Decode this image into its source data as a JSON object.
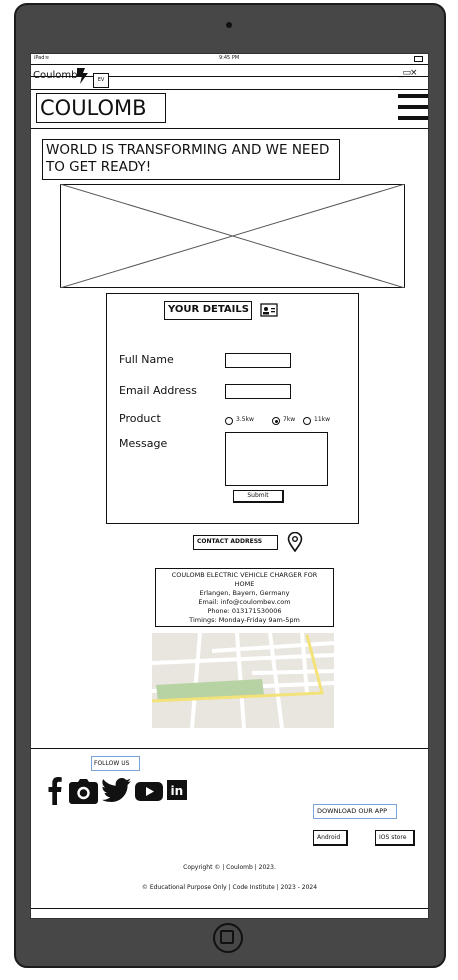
{
  "status_bar": {
    "device": "iPad",
    "time": "9:45 PM"
  },
  "browser": {
    "app_title": "Coulomb",
    "badge": "EV",
    "controls": "_▭×"
  },
  "header": {
    "logo": "COULOMB"
  },
  "hero": {
    "headline": "WORLD IS TRANSFORMING AND WE NEED TO GET READY!"
  },
  "form": {
    "title": "YOUR DETAILS",
    "fields": [
      "Full Name",
      "Email Address",
      "Product",
      "Message"
    ],
    "options": [
      {
        "label": "3.5kw",
        "selected": false
      },
      {
        "label": "7kw",
        "selected": true
      },
      {
        "label": "11kw",
        "selected": false
      }
    ],
    "submit": "Submit"
  },
  "contact": {
    "title": "CONTACT ADDRESS",
    "lines": [
      "COULOMB ELECTRIC VEHICLE CHARGER FOR",
      "HOME",
      "Erlangen, Bayern, Germany",
      "Email: info@coulombev.com",
      "Phone: 013171530006",
      "Timings: Monday-Friday 9am-5pm"
    ]
  },
  "footer": {
    "follow": "FOLLOW US",
    "social_icons": [
      "facebook-icon",
      "instagram-icon",
      "twitter-icon",
      "youtube-icon",
      "linkedin-icon"
    ],
    "download": "DOWNLOAD OUR APP",
    "android": "Android",
    "ios": "IOS store",
    "copyright": "Copyright © | Coulomb | 2023.",
    "educational": "© Educational Purpose Only | Code Institute | 2023 - 2024"
  }
}
